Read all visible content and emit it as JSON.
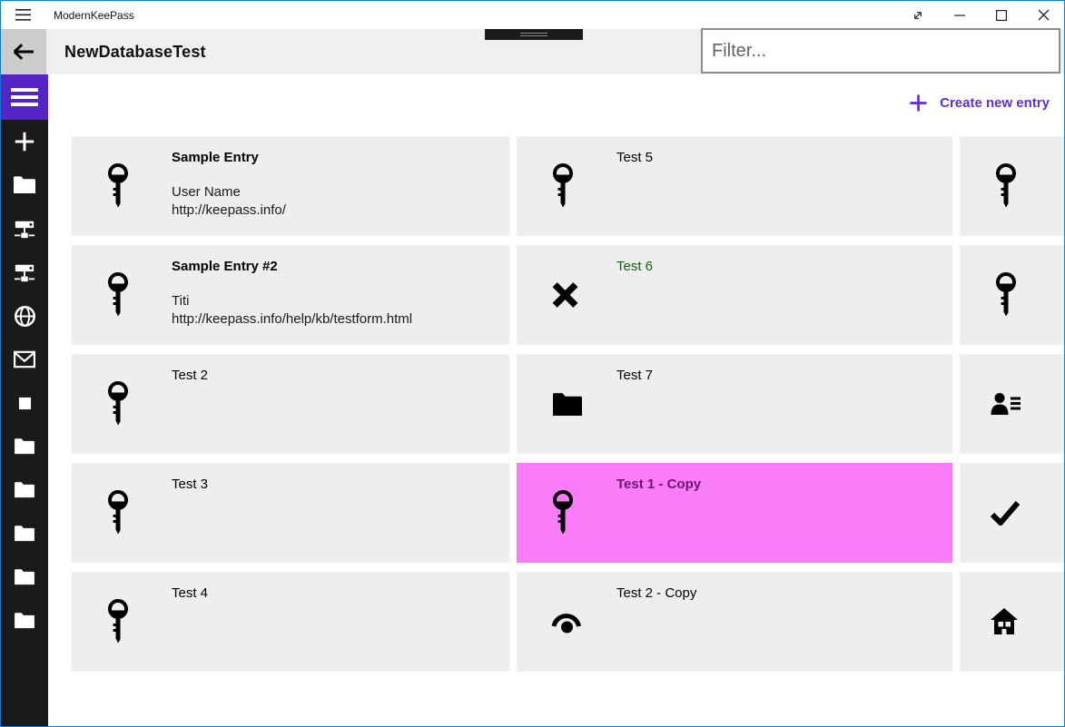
{
  "window": {
    "app_title": "ModernKeePass"
  },
  "titlebar": {
    "controls": [
      "toggle-fullscreen",
      "minimize",
      "maximize",
      "close"
    ]
  },
  "header": {
    "title": "NewDatabaseTest",
    "filter_placeholder": "Filter..."
  },
  "toolbar": {
    "create_new_entry": "Create new entry"
  },
  "sidebar": {
    "icons": [
      "hamburger",
      "plus",
      "folder",
      "server",
      "server",
      "globe",
      "mail",
      "square",
      "folder",
      "folder",
      "folder",
      "folder"
    ]
  },
  "entries": {
    "col1": [
      {
        "title": "Sample Entry",
        "bold": true,
        "icon": "key",
        "lines": [
          "User Name",
          "http://keepass.info/"
        ]
      },
      {
        "title": "Sample Entry #2",
        "bold": true,
        "icon": "key",
        "lines": [
          "Titi",
          "http://keepass.info/help/kb/testform.html"
        ]
      },
      {
        "title": "Test 2",
        "icon": "key"
      },
      {
        "title": "Test 3",
        "icon": "key"
      },
      {
        "title": "Test 4",
        "icon": "key"
      }
    ],
    "col2": [
      {
        "title": "Test 5",
        "icon": "key"
      },
      {
        "title": "Test 6",
        "icon": "cross",
        "title_color": "#156115"
      },
      {
        "title": "Test 7",
        "icon": "folder"
      },
      {
        "title": "Test 1 - Copy",
        "icon": "key",
        "selected": true,
        "title_color": "#6d156d"
      },
      {
        "title": "Test 2 - Copy",
        "icon": "eye"
      }
    ],
    "col3": [
      {
        "icon": "key"
      },
      {
        "icon": "key"
      },
      {
        "icon": "contact"
      },
      {
        "icon": "check"
      },
      {
        "icon": "home"
      }
    ]
  },
  "colors": {
    "accent_border_blue": "#0b7cd7",
    "sidebar_accent_purple": "#5524c6",
    "link_purple": "#5b2fd6",
    "selected_pink": "#f97df9",
    "selected_title": "#6d156d",
    "green_title": "#156115",
    "card_bg": "#eeeeee",
    "sidebar_bg": "#1a1a1a",
    "header_bg": "#efefef",
    "back_button_bg": "#cccccc"
  }
}
